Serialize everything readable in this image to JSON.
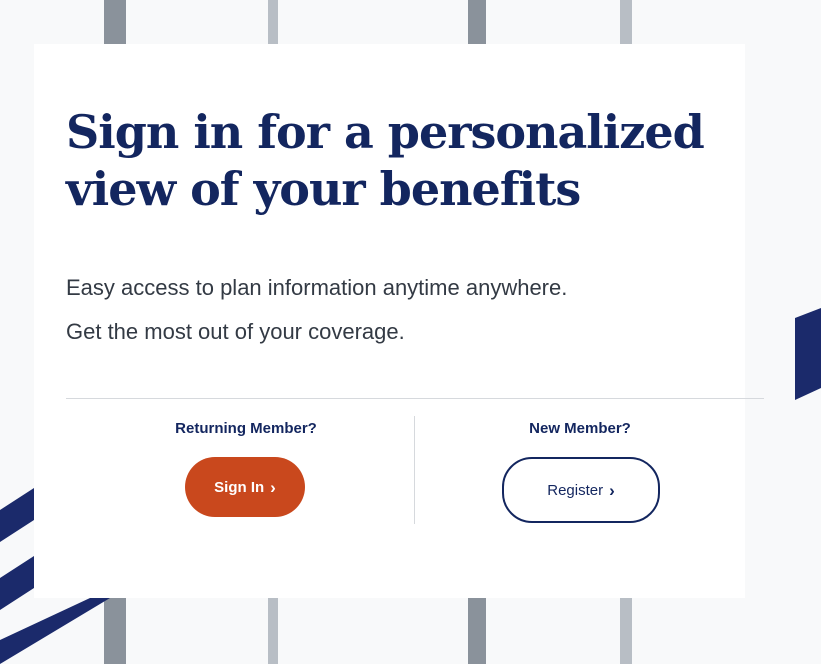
{
  "hero": {
    "headline_line1": "Sign in for a personalized",
    "headline_line2": "view of your benefits",
    "subtext_line1": "Easy access to plan information anytime anywhere.",
    "subtext_line2": "Get the most out of your coverage."
  },
  "returning": {
    "label": "Returning Member?",
    "button_label": "Sign In",
    "button_icon": "chevron-right-icon"
  },
  "new_member": {
    "label": "New Member?",
    "button_label": "Register",
    "button_icon": "chevron-right-icon"
  },
  "colors": {
    "navy": "#13265f",
    "accent_orange": "#c9481d",
    "stripe_navy": "#1b2a6b"
  }
}
